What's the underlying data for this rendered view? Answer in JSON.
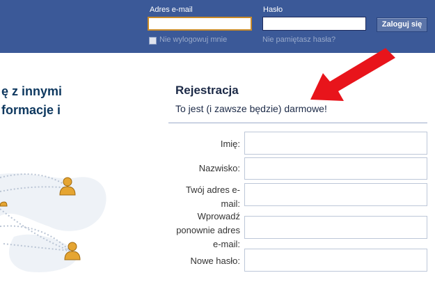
{
  "header": {
    "email_label": "Adres e-mail",
    "password_label": "Hasło",
    "email_value": "",
    "password_value": "",
    "login_button": "Zaloguj się",
    "keep_logged_in": "Nie wylogowuj mnie",
    "forgot_password": "Nie pamiętasz hasła?",
    "brand_color": "#3b5998"
  },
  "left": {
    "heading": "ę z innymi\nformacje i"
  },
  "registration": {
    "title": "Rejestracja",
    "subtitle": "To jest (i zawsze będzie) darmowe!",
    "fields": [
      {
        "label": "Imię:",
        "value": ""
      },
      {
        "label": "Nazwisko:",
        "value": ""
      },
      {
        "label": "Twój adres e-mail:",
        "value": ""
      },
      {
        "label": "Wprowadź ponownie adres e-mail:",
        "value": ""
      },
      {
        "label": "Nowe hasło:",
        "value": ""
      }
    ]
  },
  "annotation": {
    "arrow_color": "#e8141b"
  }
}
